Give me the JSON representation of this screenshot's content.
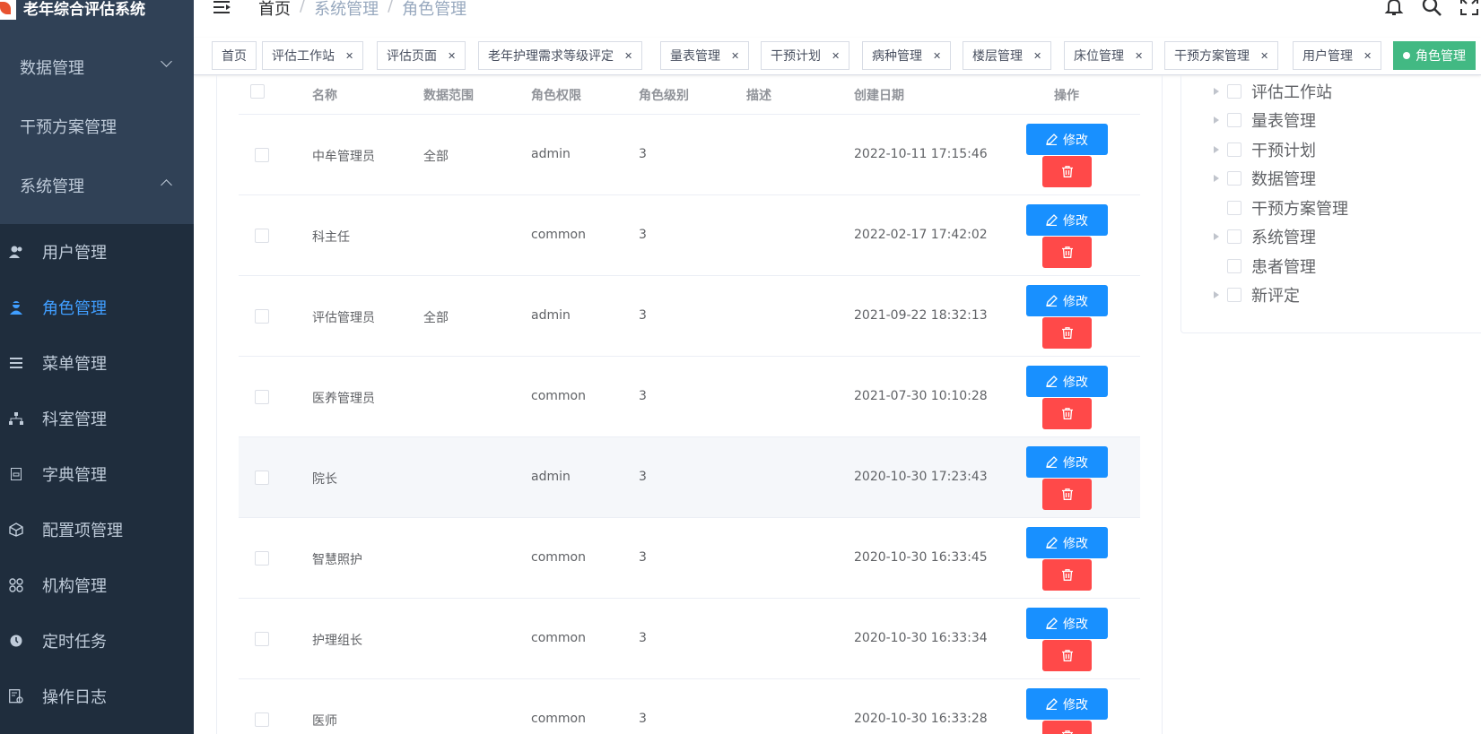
{
  "app": {
    "title": "老年综合评估系统"
  },
  "sidebar": {
    "top_items": [
      {
        "label": "数据管理",
        "expanded": false
      },
      {
        "label": "干预方案管理"
      },
      {
        "label": "系统管理",
        "expanded": true
      }
    ],
    "sub_items": [
      {
        "label": "用户管理",
        "icon": "users-icon"
      },
      {
        "label": "角色管理",
        "icon": "role-icon",
        "active": true
      },
      {
        "label": "菜单管理",
        "icon": "menu-icon"
      },
      {
        "label": "科室管理",
        "icon": "tree-org-icon"
      },
      {
        "label": "字典管理",
        "icon": "dictionary-icon"
      },
      {
        "label": "配置项管理",
        "icon": "cube-icon"
      },
      {
        "label": "机构管理",
        "icon": "grid-icon"
      },
      {
        "label": "定时任务",
        "icon": "timer-icon"
      },
      {
        "label": "操作日志",
        "icon": "log-icon"
      }
    ]
  },
  "navbar": {
    "breadcrumb": [
      "首页",
      "系统管理",
      "角色管理"
    ],
    "separator": "/"
  },
  "tags": [
    {
      "label": "首页",
      "closable": false
    },
    {
      "label": "评估工作站",
      "closable": true
    },
    {
      "label": "评估页面",
      "closable": true
    },
    {
      "label": "老年护理需求等级评定",
      "closable": true
    },
    {
      "label": "量表管理",
      "closable": true
    },
    {
      "label": "干预计划",
      "closable": true
    },
    {
      "label": "病种管理",
      "closable": true
    },
    {
      "label": "楼层管理",
      "closable": true
    },
    {
      "label": "床位管理",
      "closable": true
    },
    {
      "label": "干预方案管理",
      "closable": true
    },
    {
      "label": "用户管理",
      "closable": true
    },
    {
      "label": "角色管理",
      "active": true
    }
  ],
  "table": {
    "columns": [
      "名称",
      "数据范围",
      "角色权限",
      "角色级别",
      "描述",
      "创建日期",
      "操作"
    ],
    "rows": [
      {
        "name": "中牟管理员",
        "scope": "全部",
        "permission": "admin",
        "level": "3",
        "desc": "",
        "created": "2022-10-11 17:15:46"
      },
      {
        "name": "科主任",
        "scope": "",
        "permission": "common",
        "level": "3",
        "desc": "",
        "created": "2022-02-17 17:42:02"
      },
      {
        "name": "评估管理员",
        "scope": "全部",
        "permission": "admin",
        "level": "3",
        "desc": "",
        "created": "2021-09-22 18:32:13"
      },
      {
        "name": "医养管理员",
        "scope": "",
        "permission": "common",
        "level": "3",
        "desc": "",
        "created": "2021-07-30 10:10:28"
      },
      {
        "name": "院长",
        "scope": "",
        "permission": "admin",
        "level": "3",
        "desc": "",
        "created": "2020-10-30 17:23:43"
      },
      {
        "name": "智慧照护",
        "scope": "",
        "permission": "common",
        "level": "3",
        "desc": "",
        "created": "2020-10-30 16:33:45"
      },
      {
        "name": "护理组长",
        "scope": "",
        "permission": "common",
        "level": "3",
        "desc": "",
        "created": "2020-10-30 16:33:34"
      },
      {
        "name": "医师",
        "scope": "",
        "permission": "common",
        "level": "3",
        "desc": "",
        "created": "2020-10-30 16:33:28"
      }
    ],
    "edit_label": "修改"
  },
  "tree": {
    "nodes": [
      {
        "label": "评估工作站",
        "has_children": true
      },
      {
        "label": "量表管理",
        "has_children": true
      },
      {
        "label": "干预计划",
        "has_children": true
      },
      {
        "label": "数据管理",
        "has_children": true
      },
      {
        "label": "干预方案管理",
        "has_children": false
      },
      {
        "label": "系统管理",
        "has_children": true
      },
      {
        "label": "患者管理",
        "has_children": false
      },
      {
        "label": "新评定",
        "has_children": true
      }
    ]
  },
  "colors": {
    "sidebar_bg": "#304156",
    "submenu_bg": "#1f2d3d",
    "accent": "#409eff",
    "edit_button": "#1890ff",
    "delete_button": "#ff4949",
    "active_tag": "#42b983"
  }
}
